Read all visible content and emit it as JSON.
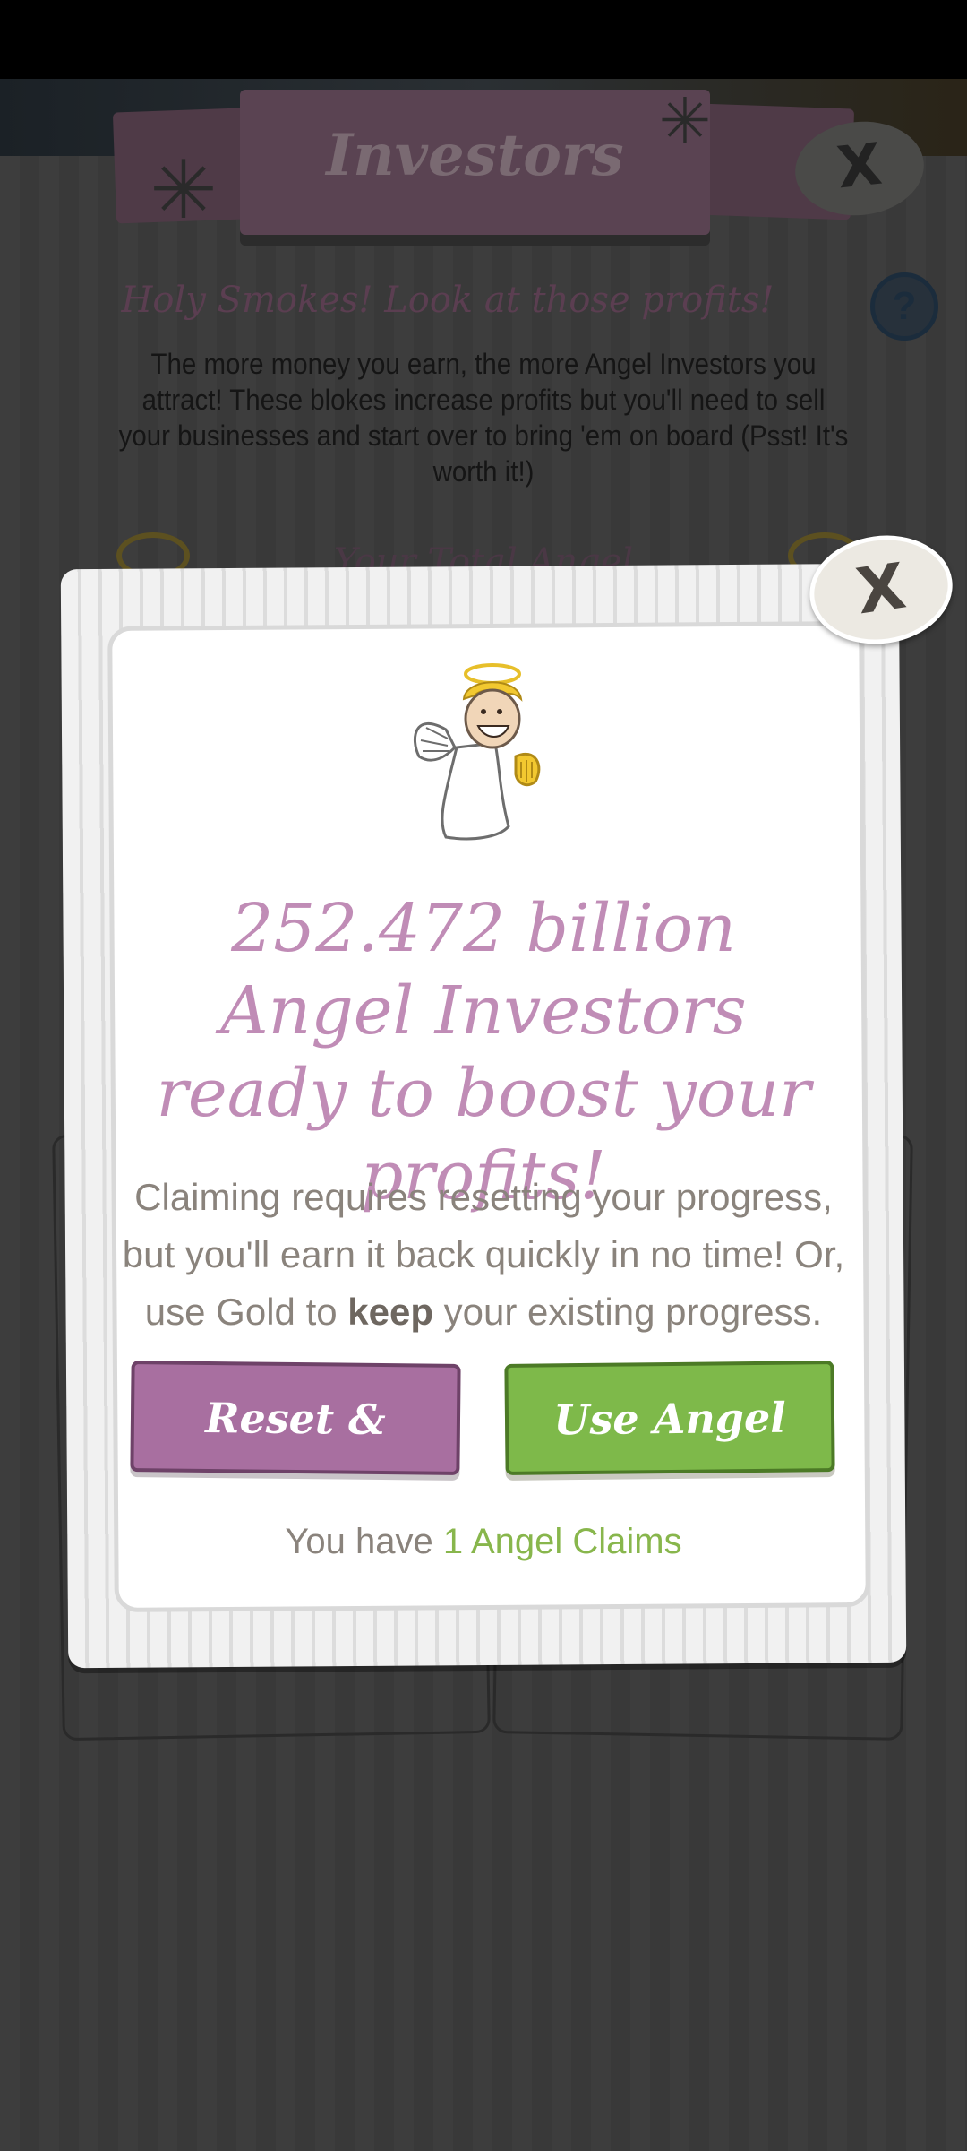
{
  "background": {
    "title": "Investors",
    "headline": "Holy Smokes! Look at those profits!",
    "description": "The more money you earn, the more Angel Investors you attract! These blokes increase profits but you'll need to sell your businesses and start over to bring 'em on board (Psst! It's worth it!)",
    "subtitle": "Your Total Angel",
    "close_label": "X",
    "help_label": "?"
  },
  "modal": {
    "close_label": "X",
    "headline": "252.472 billion Angel Investors ready to boost your profits!",
    "body_before": "Claiming requires resetting your progress, but you'll earn it back quickly in no time! Or, use Gold to ",
    "body_bold": "keep",
    "body_after": " your existing progress.",
    "reset_button_label": "Reset & Claim",
    "use_claim_button_label": "Use Angel Claim",
    "claims_prefix": "You have ",
    "claims_value": "1 Angel Claims"
  },
  "colors": {
    "headline": "#c08cb6",
    "reset_button": "#a86fa0",
    "use_claim_button": "#7eb94a",
    "claims_highlight": "#88b64c"
  },
  "icons": {
    "close": "close-x-icon",
    "help": "question-mark-icon",
    "mascot": "angel-investor-mascot"
  }
}
